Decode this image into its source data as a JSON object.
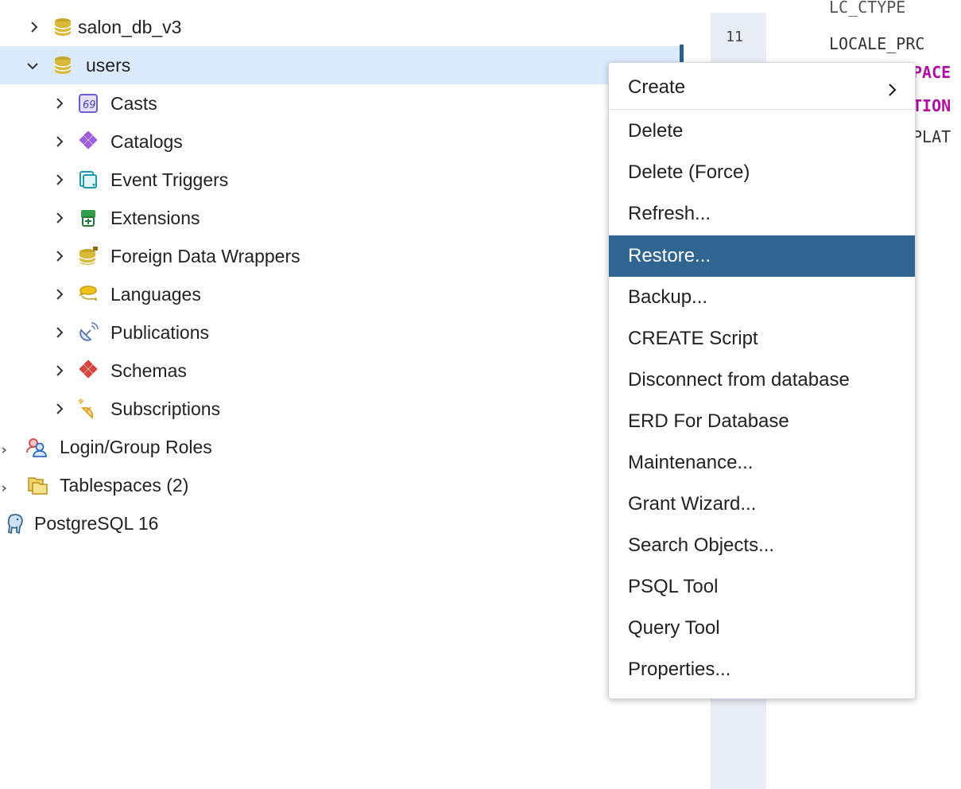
{
  "tree": {
    "items": [
      {
        "label": "salon_db_v3",
        "icon": "database-icon",
        "expanded": false
      },
      {
        "label": "users",
        "icon": "database-icon",
        "expanded": true,
        "selected": true
      },
      {
        "label": "Casts",
        "icon": "casts-icon"
      },
      {
        "label": "Catalogs",
        "icon": "catalogs-icon"
      },
      {
        "label": "Event Triggers",
        "icon": "event-triggers-icon"
      },
      {
        "label": "Extensions",
        "icon": "extensions-icon"
      },
      {
        "label": "Foreign Data Wrappers",
        "icon": "foreign-data-wrappers-icon"
      },
      {
        "label": "Languages",
        "icon": "languages-icon"
      },
      {
        "label": "Publications",
        "icon": "publications-icon"
      },
      {
        "label": "Schemas",
        "icon": "schemas-icon"
      },
      {
        "label": "Subscriptions",
        "icon": "subscriptions-icon"
      },
      {
        "label": "Login/Group Roles",
        "icon": "roles-icon"
      },
      {
        "label": "Tablespaces (2)",
        "icon": "tablespaces-icon"
      },
      {
        "label": "PostgreSQL 16",
        "icon": "postgresql-elephant-icon"
      }
    ]
  },
  "editor": {
    "line_number": "11",
    "lines": [
      "LC_CTYPE",
      "LOCALE_PRC",
      "PACE",
      "TION",
      "PLAT"
    ]
  },
  "context_menu": {
    "items": [
      {
        "label": "Create",
        "has_submenu": true
      },
      {
        "label": "Delete"
      },
      {
        "label": "Delete (Force)"
      },
      {
        "label": "Refresh..."
      },
      {
        "label": "Restore...",
        "highlighted": true
      },
      {
        "label": "Backup..."
      },
      {
        "label": "CREATE Script"
      },
      {
        "label": "Disconnect from database"
      },
      {
        "label": "ERD For Database"
      },
      {
        "label": "Maintenance..."
      },
      {
        "label": "Grant Wizard..."
      },
      {
        "label": "Search Objects..."
      },
      {
        "label": "PSQL Tool"
      },
      {
        "label": "Query Tool"
      },
      {
        "label": "Properties..."
      }
    ]
  },
  "colors": {
    "selected_row": "#dbeafd",
    "menu_highlight": "#2f6590",
    "keyword": "#b00fa0"
  }
}
